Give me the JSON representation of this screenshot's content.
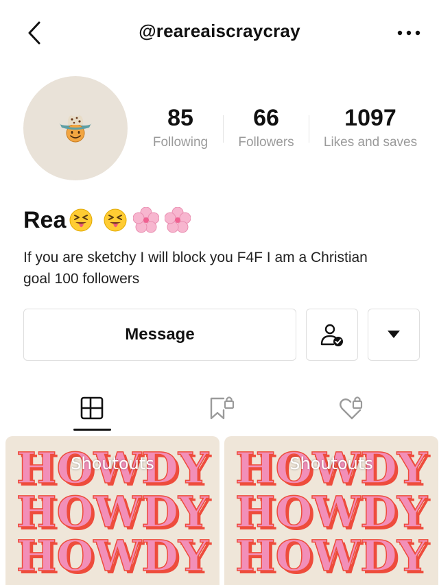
{
  "header": {
    "username": "@reareaiscraycray",
    "back_icon": "chevron-left-icon",
    "more_icon": "more-dots-icon"
  },
  "profile": {
    "avatar_icon": "cowboy-smiley-icon",
    "display_name": "Rea",
    "name_emojis": [
      "squinting-tongue-face",
      "squinting-tongue-face",
      "cherry-blossom",
      "cherry-blossom"
    ],
    "bio_line1": "If you are sketchy I will block you F4F I am a Christian",
    "bio_line2": "goal 100 followers"
  },
  "stats": [
    {
      "value": "85",
      "label": "Following"
    },
    {
      "value": "66",
      "label": "Followers"
    },
    {
      "value": "1097",
      "label": "Likes and saves"
    }
  ],
  "actions": {
    "message_label": "Message",
    "follow_icon": "user-check-icon",
    "dropdown_icon": "triangle-down-icon"
  },
  "tabs": [
    {
      "icon": "grid-icon",
      "active": true
    },
    {
      "icon": "bookmark-lock-icon",
      "active": false
    },
    {
      "icon": "heart-lock-icon",
      "active": false
    }
  ],
  "posts": [
    {
      "title": "Shoutouts",
      "art_text": "HOWDY"
    },
    {
      "title": "Shoutouts",
      "art_text": "HOWDY"
    }
  ],
  "colors": {
    "howdy_pink": "#f28fb8",
    "howdy_red": "#ee4c3c",
    "card_bg": "#efe6d9",
    "avatar_bg": "#e9e2d8"
  }
}
